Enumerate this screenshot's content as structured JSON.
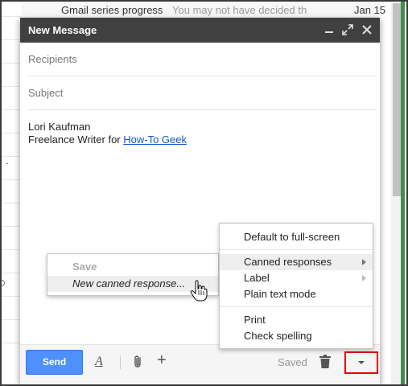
{
  "background": {
    "top_row": {
      "subject": "Gmail series progress",
      "snippet": "You may not have decided th",
      "date": "Jan 15"
    }
  },
  "compose": {
    "title": "New Message",
    "recipients_placeholder": "Recipients",
    "subject_placeholder": "Subject",
    "signature": {
      "name": "Lori Kaufman",
      "line_prefix": "Freelance Writer for ",
      "link_text": "How-To Geek"
    },
    "toolbar": {
      "send_label": "Send",
      "format_label": "A",
      "insert_label": "+",
      "saved_label": "Saved"
    }
  },
  "more_menu": {
    "items": [
      "Default to full-screen",
      "Canned responses",
      "Label",
      "Plain text mode",
      "Print",
      "Check spelling"
    ]
  },
  "canned_submenu": {
    "save_label": "Save",
    "new_label": "New canned response..."
  },
  "colors": {
    "header_bg": "#404040",
    "send_button": "#4d90fe",
    "link": "#1155cc",
    "highlight_box": "#e00000"
  }
}
